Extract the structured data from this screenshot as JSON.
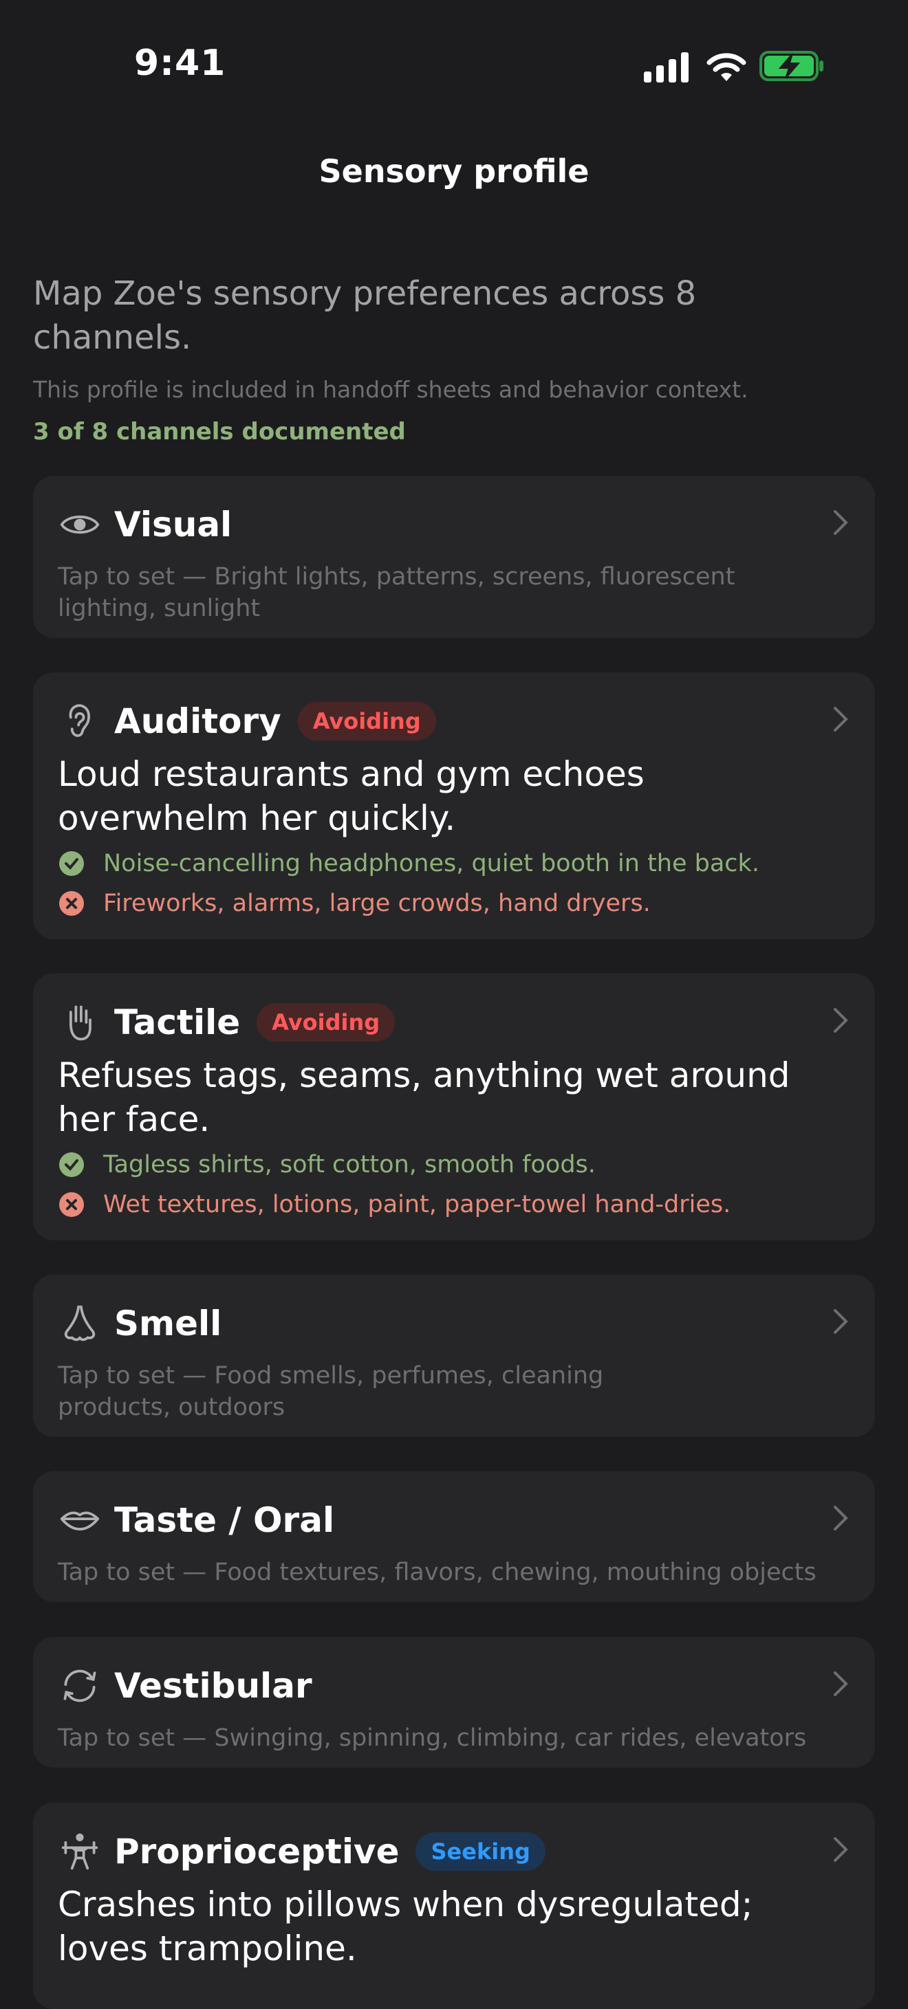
{
  "status_bar": {
    "time": "9:41"
  },
  "nav": {
    "title": "Sensory profile"
  },
  "intro": {
    "headline": "Map Zoe's sensory preferences across 8 channels.",
    "subtitle": "This profile is included in handoff sheets and behavior context.",
    "progress": "3 of 8 channels documented"
  },
  "colors": {
    "background": "#1c1c1e",
    "card": "#262628",
    "like": "#8fb27a",
    "dislike": "#e98a7a",
    "avoiding_badge": "#ff5a5a",
    "seeking_badge": "#2f9bff"
  },
  "channels": [
    {
      "icon": "eye-icon",
      "title": "Visual",
      "hint": "Tap to set — Bright lights, patterns, screens, fluorescent lighting, sunlight"
    },
    {
      "icon": "ear-icon",
      "title": "Auditory",
      "badge": "Avoiding",
      "description": "Loud restaurants and gym echoes overwhelm her quickly.",
      "likes": "Noise-cancelling headphones, quiet booth in the back.",
      "dislikes": "Fireworks, alarms, large crowds, hand dryers."
    },
    {
      "icon": "hand-icon",
      "title": "Tactile",
      "badge": "Avoiding",
      "description": "Refuses tags, seams, anything wet around her face.",
      "likes": "Tagless shirts, soft cotton, smooth foods.",
      "dislikes": "Wet textures, lotions, paint, paper-towel hand-dries."
    },
    {
      "icon": "nose-icon",
      "title": "Smell",
      "hint": "Tap to set — Food smells, perfumes, cleaning products, outdoors"
    },
    {
      "icon": "lips-icon",
      "title": "Taste / Oral",
      "hint": "Tap to set — Food textures, flavors, chewing, mouthing objects"
    },
    {
      "icon": "rotate-icon",
      "title": "Vestibular",
      "hint": "Tap to set — Swinging, spinning, climbing, car rides, elevators"
    },
    {
      "icon": "weightlifter-icon",
      "title": "Proprioceptive",
      "badge": "Seeking",
      "description": "Crashes into pillows when dysregulated; loves trampoline."
    }
  ]
}
